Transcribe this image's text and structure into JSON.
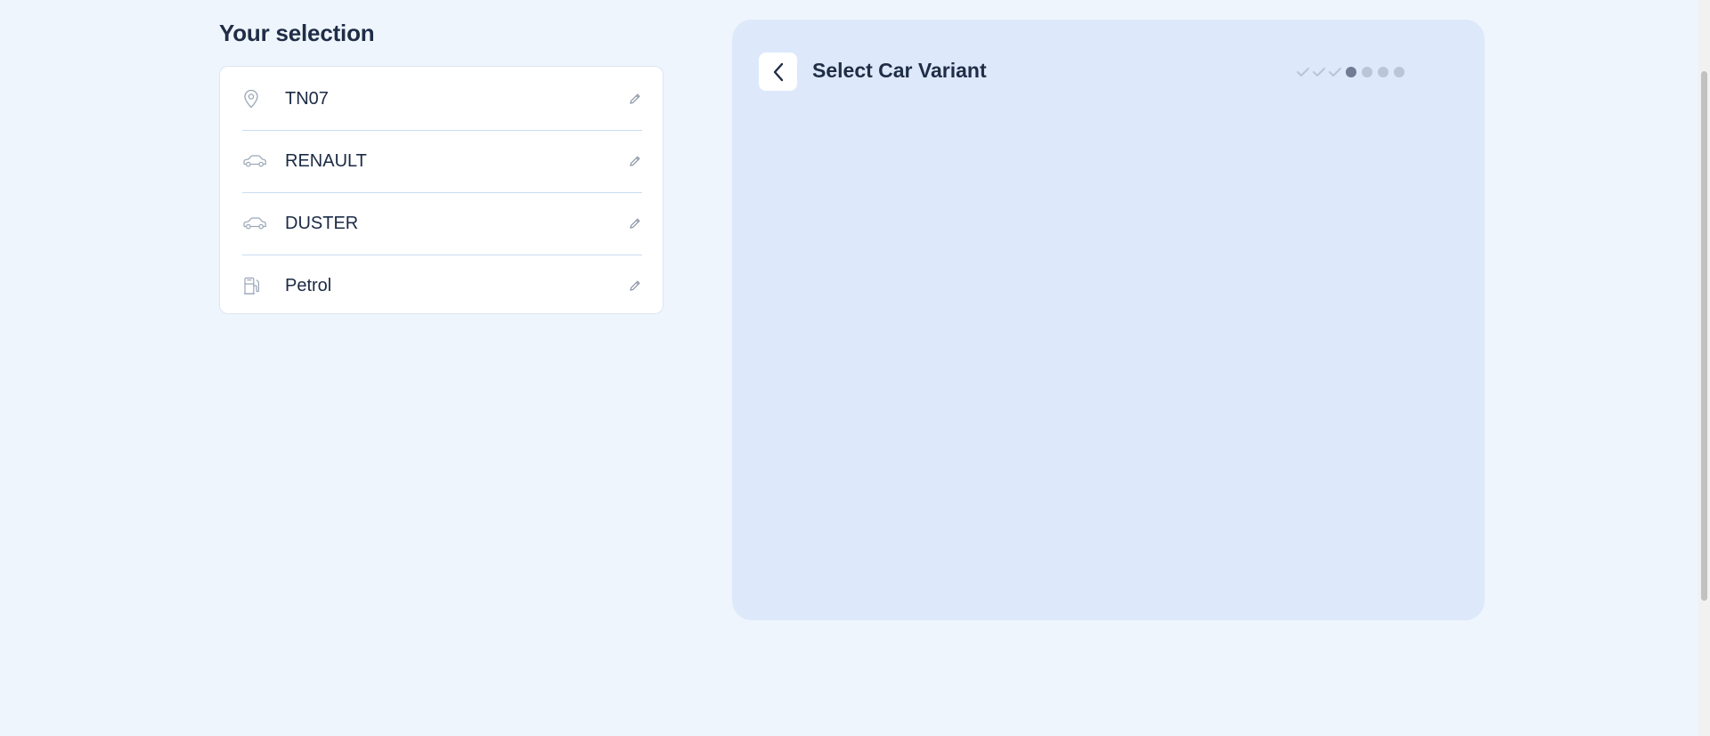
{
  "selection": {
    "heading": "Your selection",
    "items": [
      {
        "label": "TN07",
        "icon": "location-pin-icon"
      },
      {
        "label": "RENAULT",
        "icon": "car-icon"
      },
      {
        "label": "DUSTER",
        "icon": "car-icon"
      },
      {
        "label": "Petrol",
        "icon": "fuel-pump-icon"
      }
    ]
  },
  "variant_panel": {
    "title": "Select Car Variant",
    "progress": {
      "total_steps": 7,
      "completed_steps": 3,
      "current_step": 4
    }
  },
  "colors": {
    "page_background": "#eff5fd",
    "panel_background": "#dde9fb",
    "text_primary": "#1f2d46",
    "divider": "#c9dcf1",
    "step_inactive": "#b9c6d6",
    "step_current": "#6f7c91"
  }
}
